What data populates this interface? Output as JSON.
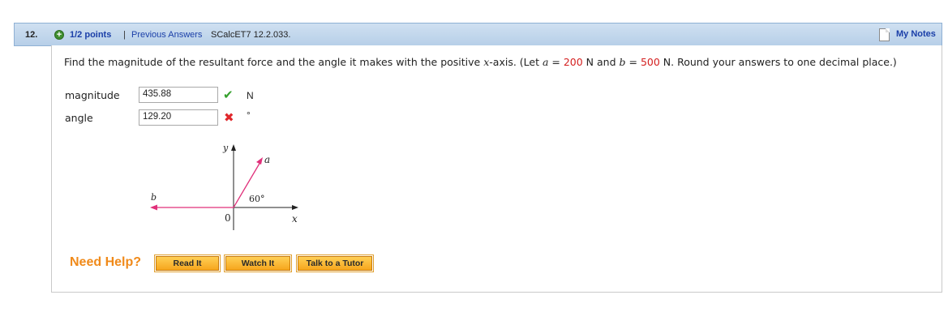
{
  "header": {
    "question_number": "12.",
    "points": "1/2 points",
    "separator": "|",
    "previous_answers": "Previous Answers",
    "problem_code": "SCalcET7 12.2.033.",
    "my_notes": "My Notes"
  },
  "question": {
    "text_1": "Find the magnitude of the resultant force and the angle it makes with the positive ",
    "x_var": "x",
    "text_2": "-axis. (Let ",
    "a_var": "a",
    "eq1": " = ",
    "a_value": "200",
    "text_3": " N and ",
    "b_var": "b",
    "eq2": " = ",
    "b_value": "500",
    "text_4": " N. Round your answers to one decimal place.)"
  },
  "answers": [
    {
      "label": "magnitude",
      "value": "435.88",
      "status": "correct",
      "unit": "N"
    },
    {
      "label": "angle",
      "value": "129.20",
      "status": "incorrect",
      "unit": "°"
    }
  ],
  "diagram": {
    "y_label": "y",
    "x_label": "x",
    "a_label": "a",
    "b_label": "b",
    "origin_label": "0",
    "angle_label": "60°",
    "vector_color": "#e0307a"
  },
  "help": {
    "label": "Need Help?",
    "read_it": "Read It",
    "watch_it": "Watch It",
    "talk_to_tutor": "Talk to a Tutor"
  },
  "colors": {
    "link": "#1a3fa8",
    "highlight": "#d42020",
    "help": "#f08a1a",
    "correct": "#34a02c",
    "incorrect": "#e0282c"
  }
}
